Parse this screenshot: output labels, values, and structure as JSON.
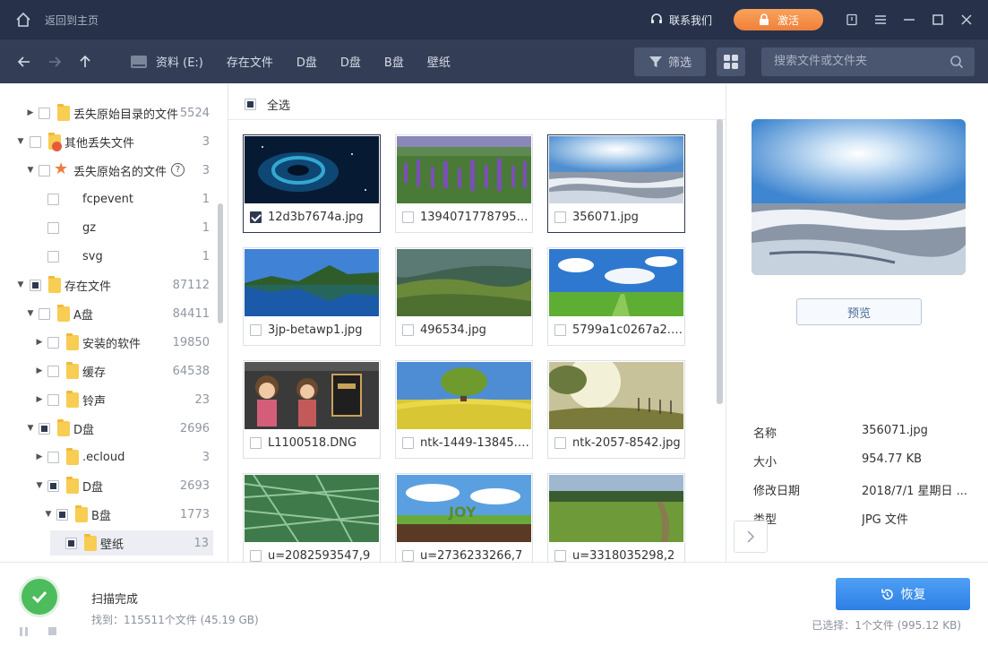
{
  "titlebar": {
    "home_label": "返回到主页",
    "contact_label": "联系我们",
    "activate_label": "激活"
  },
  "nav": {
    "breadcrumbs": [
      "资料 (E:)",
      "存在文件",
      "D盘",
      "D盘",
      "B盘",
      "壁纸"
    ],
    "filter_label": "筛选",
    "search_placeholder": "搜索文件或文件夹"
  },
  "tree": [
    {
      "label": "丢失原始目录的文件",
      "count": "5524"
    },
    {
      "label": "其他丢失文件",
      "count": "3"
    },
    {
      "label": "丢失原始名的文件",
      "count": "3"
    },
    {
      "label": "fcpevent",
      "count": "1"
    },
    {
      "label": "gz",
      "count": "1"
    },
    {
      "label": "svg",
      "count": "1"
    },
    {
      "label": "存在文件",
      "count": "87112"
    },
    {
      "label": "A盘",
      "count": "84411"
    },
    {
      "label": "安装的软件",
      "count": "19850"
    },
    {
      "label": "缓存",
      "count": "64538"
    },
    {
      "label": "铃声",
      "count": "23"
    },
    {
      "label": "D盘",
      "count": "2696"
    },
    {
      "label": ".ecloud",
      "count": "3"
    },
    {
      "label": "D盘",
      "count": "2693"
    },
    {
      "label": "B盘",
      "count": "1773"
    },
    {
      "label": "壁纸",
      "count": "13"
    }
  ],
  "grid": {
    "select_all_label": "全选",
    "files": [
      {
        "name": "12d3b7674a.jpg",
        "thumb": "nebula"
      },
      {
        "name": "1394071778795.jpg",
        "thumb": "lupine"
      },
      {
        "name": "356071.jpg",
        "thumb": "icesun"
      },
      {
        "name": "3jp-betawp1.jpg",
        "thumb": "lake"
      },
      {
        "name": "496534.jpg",
        "thumb": "valley"
      },
      {
        "name": "5799a1c0267a2.jpg",
        "thumb": "clouds"
      },
      {
        "name": "L1100518.DNG",
        "thumb": "cartoon"
      },
      {
        "name": "ntk-1449-13845.jpg",
        "thumb": "tree"
      },
      {
        "name": "ntk-2057-8542.jpg",
        "thumb": "fog"
      },
      {
        "name": "u=2082593547,9",
        "thumb": "grass"
      },
      {
        "name": "u=2736233266,7",
        "thumb": "joy"
      },
      {
        "name": "u=3318035298,2",
        "thumb": "field"
      }
    ]
  },
  "details": {
    "preview_label": "预览",
    "fields": [
      {
        "key": "名称",
        "value": "356071.jpg"
      },
      {
        "key": "大小",
        "value": "954.77 KB"
      },
      {
        "key": "修改日期",
        "value": "2018/7/1 星期日 ..."
      },
      {
        "key": "类型",
        "value": "JPG 文件"
      }
    ]
  },
  "status": {
    "title": "扫描完成",
    "found": "找到：115511个文件 (45.19 GB)",
    "recover_label": "恢复",
    "selected_info": "已选择：1个文件 (995.12 KB)"
  },
  "colors": {
    "titlebar": "#27324a",
    "navbar": "#333e56",
    "accent_orange": "#f0803a",
    "accent_blue": "#2d7fe4",
    "success_green": "#4cbc5d"
  }
}
